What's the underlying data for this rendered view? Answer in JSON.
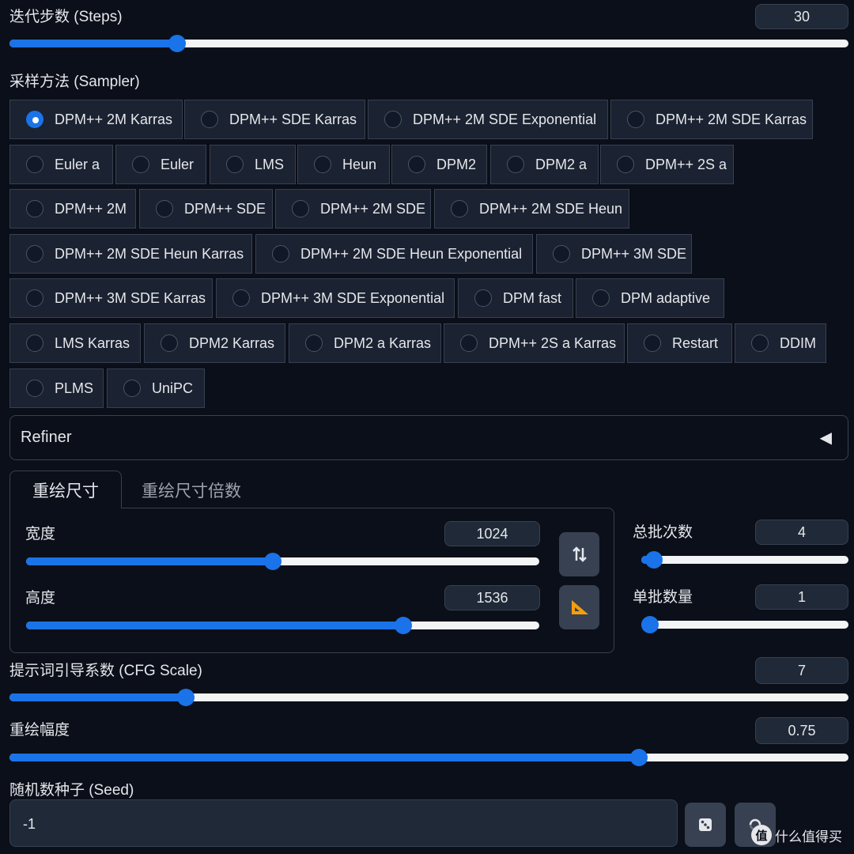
{
  "steps": {
    "label": "迭代步数 (Steps)",
    "value": "30",
    "fraction": 0.2
  },
  "sampler": {
    "label": "采样方法 (Sampler)",
    "selected": "DPM++ 2M Karras",
    "options": [
      "DPM++ 2M Karras",
      "DPM++ SDE Karras",
      "DPM++ 2M SDE Exponential",
      "DPM++ 2M SDE Karras",
      "Euler a",
      "Euler",
      "LMS",
      "Heun",
      "DPM2",
      "DPM2 a",
      "DPM++ 2S a",
      "DPM++ 2M",
      "DPM++ SDE",
      "DPM++ 2M SDE",
      "DPM++ 2M SDE Heun",
      "DPM++ 2M SDE Heun Karras",
      "DPM++ 2M SDE Heun Exponential",
      "DPM++ 3M SDE",
      "DPM++ 3M SDE Karras",
      "DPM++ 3M SDE Exponential",
      "DPM fast",
      "DPM adaptive",
      "LMS Karras",
      "DPM2 Karras",
      "DPM2 a Karras",
      "DPM++ 2S a Karras",
      "Restart",
      "DDIM",
      "PLMS",
      "UniPC"
    ]
  },
  "refiner": {
    "label": "Refiner",
    "arrow": "◀"
  },
  "tabs": {
    "active": "重绘尺寸",
    "inactive": "重绘尺寸倍数"
  },
  "width": {
    "label": "宽度",
    "value": "1024",
    "fraction": 0.48
  },
  "height": {
    "label": "高度",
    "value": "1536",
    "fraction": 0.735
  },
  "swap_icon": "swap-vertical-icon",
  "ratio_icon": "triangle-ruler-icon",
  "batch_count": {
    "label": "总批次数",
    "value": "4",
    "fraction": 0.06
  },
  "batch_size": {
    "label": "单批数量",
    "value": "1",
    "fraction": 0.0
  },
  "cfg": {
    "label": "提示词引导系数 (CFG Scale)",
    "value": "7",
    "fraction": 0.21
  },
  "denoise": {
    "label": "重绘幅度",
    "value": "0.75",
    "fraction": 0.75
  },
  "seed": {
    "label": "随机数种子 (Seed)",
    "value": "-1"
  },
  "watermark": "什么值得买",
  "colors": {
    "accent": "#1a73e8",
    "background": "#0b0f19",
    "border": "#374151"
  }
}
